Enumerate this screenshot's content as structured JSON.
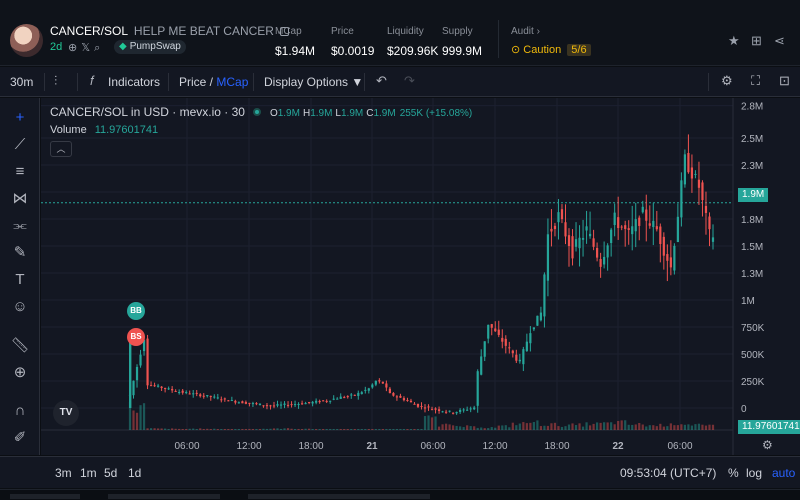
{
  "header": {
    "pair": "CANCER/SOL",
    "token_name": "HELP ME BEAT CANCER",
    "age": "2d",
    "dex": "PumpSwap",
    "stats": [
      {
        "label": "MCap",
        "value": "$1.94M"
      },
      {
        "label": "Price",
        "value": "$0.0019"
      },
      {
        "label": "Liquidity",
        "value": "$209.96K"
      },
      {
        "label": "Supply",
        "value": "999.9M"
      }
    ],
    "audit_label": "Audit",
    "caution_label": "Caution",
    "caution_count": "5/6",
    "icons": [
      "star-icon",
      "add-watchlist-icon",
      "share-icon"
    ]
  },
  "toolbar": {
    "interval": "30m",
    "indicators": "Indicators",
    "price_label": "Price",
    "slash": " / ",
    "mcap_label": "MCap",
    "display_options": "Display Options ▼"
  },
  "legend": {
    "title": "CANCER/SOL in USD · mevx.io · 30",
    "o_key": "O",
    "o_val": "1.9M",
    "h_key": "H",
    "h_val": "1.9M",
    "l_key": "L",
    "l_val": "1.9M",
    "c_key": "C",
    "c_val": "1.9M",
    "change": "255K (+15.08%)",
    "volume_label": "Volume",
    "volume_value": "11.97601741"
  },
  "markers": {
    "buy": "BB",
    "sell": "BS"
  },
  "chart_data": {
    "type": "candlestick",
    "y_axis_labels": [
      "2.8M",
      "2.5M",
      "2.3M",
      "2M",
      "1.8M",
      "1.5M",
      "1.3M",
      "1M",
      "750K",
      "500K",
      "250K",
      "0"
    ],
    "ylim": [
      -100000,
      2800000
    ],
    "x_axis_labels": [
      "06:00",
      "12:00",
      "18:00",
      "21",
      "06:00",
      "12:00",
      "18:00",
      "22",
      "06:00"
    ],
    "last_price_label": "1.9M",
    "last_price": 1900000,
    "volume_label": "11.97601741",
    "trend": [
      [
        0,
        120000
      ],
      [
        4,
        650000
      ],
      [
        5,
        220000
      ],
      [
        14,
        150000
      ],
      [
        22,
        110000
      ],
      [
        30,
        60000
      ],
      [
        40,
        20000
      ],
      [
        50,
        45000
      ],
      [
        56,
        70000
      ],
      [
        60,
        100000
      ],
      [
        64,
        120000
      ],
      [
        68,
        180000
      ],
      [
        70,
        250000
      ],
      [
        72,
        230000
      ],
      [
        74,
        130000
      ],
      [
        78,
        80000
      ],
      [
        82,
        20000
      ],
      [
        88,
        -20000
      ],
      [
        92,
        -40000
      ],
      [
        98,
        5000
      ],
      [
        99,
        330000
      ],
      [
        102,
        780000
      ],
      [
        106,
        620000
      ],
      [
        108,
        540000
      ],
      [
        111,
        420000
      ],
      [
        114,
        720000
      ],
      [
        117,
        880000
      ],
      [
        119,
        1600000
      ],
      [
        122,
        1780000
      ],
      [
        126,
        1450000
      ],
      [
        130,
        1650000
      ],
      [
        134,
        1350000
      ],
      [
        138,
        1750000
      ],
      [
        142,
        1600000
      ],
      [
        146,
        1800000
      ],
      [
        150,
        1650000
      ],
      [
        154,
        1300000
      ],
      [
        158,
        2300000
      ],
      [
        162,
        2050000
      ],
      [
        165,
        1600000
      ]
    ],
    "volume_heights": [
      0.9,
      0.06,
      0.05,
      0.04,
      0.05,
      0.04,
      0.03,
      0.03,
      0.04,
      0.05,
      0.06,
      0.05,
      0.04,
      0.03,
      0.03,
      0.02,
      0.02,
      0.02,
      0.02,
      0.03,
      0.7,
      0.2,
      0.14,
      0.12,
      0.1,
      0.15,
      0.25,
      0.3,
      0.22,
      0.18,
      0.2,
      0.24,
      0.26,
      0.3,
      0.22,
      0.18,
      0.2,
      0.26,
      0.22,
      0.16
    ]
  },
  "bottom": {
    "ranges": [
      "3m",
      "1m",
      "5d",
      "1d"
    ],
    "time": "09:53:04 (UTC+7)",
    "pct": "%",
    "log": "log",
    "auto": "auto"
  },
  "colors": {
    "up": "#26a69a",
    "down": "#ef5350",
    "accent": "#2962ff",
    "caution": "#f0b90b"
  }
}
